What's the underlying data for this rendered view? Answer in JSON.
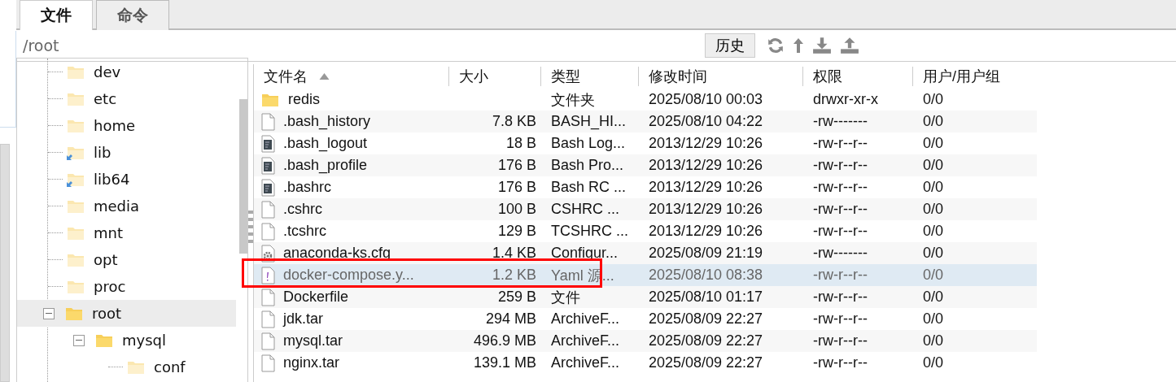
{
  "tabs": [
    {
      "label": "文件",
      "selected": true
    },
    {
      "label": "命令",
      "selected": false
    }
  ],
  "path": {
    "value": "/root"
  },
  "toolbar": {
    "history_button": "历史"
  },
  "tree": [
    {
      "name": "dev",
      "link": false
    },
    {
      "name": "etc",
      "link": false
    },
    {
      "name": "home",
      "link": false
    },
    {
      "name": "lib",
      "link": true
    },
    {
      "name": "lib64",
      "link": true
    },
    {
      "name": "media",
      "link": false
    },
    {
      "name": "mnt",
      "link": false
    },
    {
      "name": "opt",
      "link": false
    },
    {
      "name": "proc",
      "link": false
    },
    {
      "name": "root",
      "link": false,
      "selected": true,
      "expanded": true,
      "children": [
        {
          "name": "mysql",
          "link": false,
          "expanded": true,
          "children": [
            {
              "name": "conf",
              "link": false
            }
          ]
        }
      ]
    }
  ],
  "table": {
    "columns": [
      {
        "label": "文件名",
        "sorted": true
      },
      {
        "label": "大小",
        "sorted": false
      },
      {
        "label": "类型",
        "sorted": false
      },
      {
        "label": "修改时间",
        "sorted": false
      },
      {
        "label": "权限",
        "sorted": false
      },
      {
        "label": "用户/用户组",
        "sorted": false
      }
    ],
    "rows": [
      {
        "kind": "folder",
        "name": "redis",
        "size": "",
        "type": "文件夹",
        "modified": "2025/08/10 00:03",
        "permissions": "drwxr-xr-x",
        "owner": "0/0",
        "selected": false
      },
      {
        "kind": "file",
        "name": ".bash_history",
        "size": "7.8 KB",
        "type": "BASH_HI...",
        "modified": "2025/08/10 04:22",
        "permissions": "-rw-------",
        "owner": "0/0",
        "selected": false
      },
      {
        "kind": "script",
        "name": ".bash_logout",
        "size": "18 B",
        "type": "Bash Log...",
        "modified": "2013/12/29 10:26",
        "permissions": "-rw-r--r--",
        "owner": "0/0",
        "selected": false
      },
      {
        "kind": "script",
        "name": ".bash_profile",
        "size": "176 B",
        "type": "Bash Pro...",
        "modified": "2013/12/29 10:26",
        "permissions": "-rw-r--r--",
        "owner": "0/0",
        "selected": false
      },
      {
        "kind": "script",
        "name": ".bashrc",
        "size": "176 B",
        "type": "Bash RC ...",
        "modified": "2013/12/29 10:26",
        "permissions": "-rw-r--r--",
        "owner": "0/0",
        "selected": false
      },
      {
        "kind": "file",
        "name": ".cshrc",
        "size": "100 B",
        "type": "CSHRC ...",
        "modified": "2013/12/29 10:26",
        "permissions": "-rw-r--r--",
        "owner": "0/0",
        "selected": false
      },
      {
        "kind": "file",
        "name": ".tcshrc",
        "size": "129 B",
        "type": "TCSHRC ...",
        "modified": "2013/12/29 10:26",
        "permissions": "-rw-r--r--",
        "owner": "0/0",
        "selected": false
      },
      {
        "kind": "config",
        "name": "anaconda-ks.cfg",
        "size": "1.4 KB",
        "type": "Configur...",
        "modified": "2025/08/09 21:19",
        "permissions": "-rw-------",
        "owner": "0/0",
        "selected": false
      },
      {
        "kind": "yaml",
        "name": "docker-compose.y...",
        "size": "1.2 KB",
        "type": "Yaml 源...",
        "modified": "2025/08/10 08:38",
        "permissions": "-rw-r--r--",
        "owner": "0/0",
        "selected": true
      },
      {
        "kind": "file",
        "name": "Dockerfile",
        "size": "259 B",
        "type": "文件",
        "modified": "2025/08/10 01:17",
        "permissions": "-rw-r--r--",
        "owner": "0/0",
        "selected": false
      },
      {
        "kind": "file",
        "name": "jdk.tar",
        "size": "294 MB",
        "type": "ArchiveF...",
        "modified": "2025/08/09 22:27",
        "permissions": "-rw-r--r--",
        "owner": "0/0",
        "selected": false
      },
      {
        "kind": "file",
        "name": "mysql.tar",
        "size": "496.9 MB",
        "type": "ArchiveF...",
        "modified": "2025/08/09 22:27",
        "permissions": "-rw-r--r--",
        "owner": "0/0",
        "selected": false
      },
      {
        "kind": "file",
        "name": "nginx.tar",
        "size": "139.1 MB",
        "type": "ArchiveF...",
        "modified": "2025/08/09 22:27",
        "permissions": "-rw-r--r--",
        "owner": "0/0",
        "selected": false
      }
    ]
  }
}
